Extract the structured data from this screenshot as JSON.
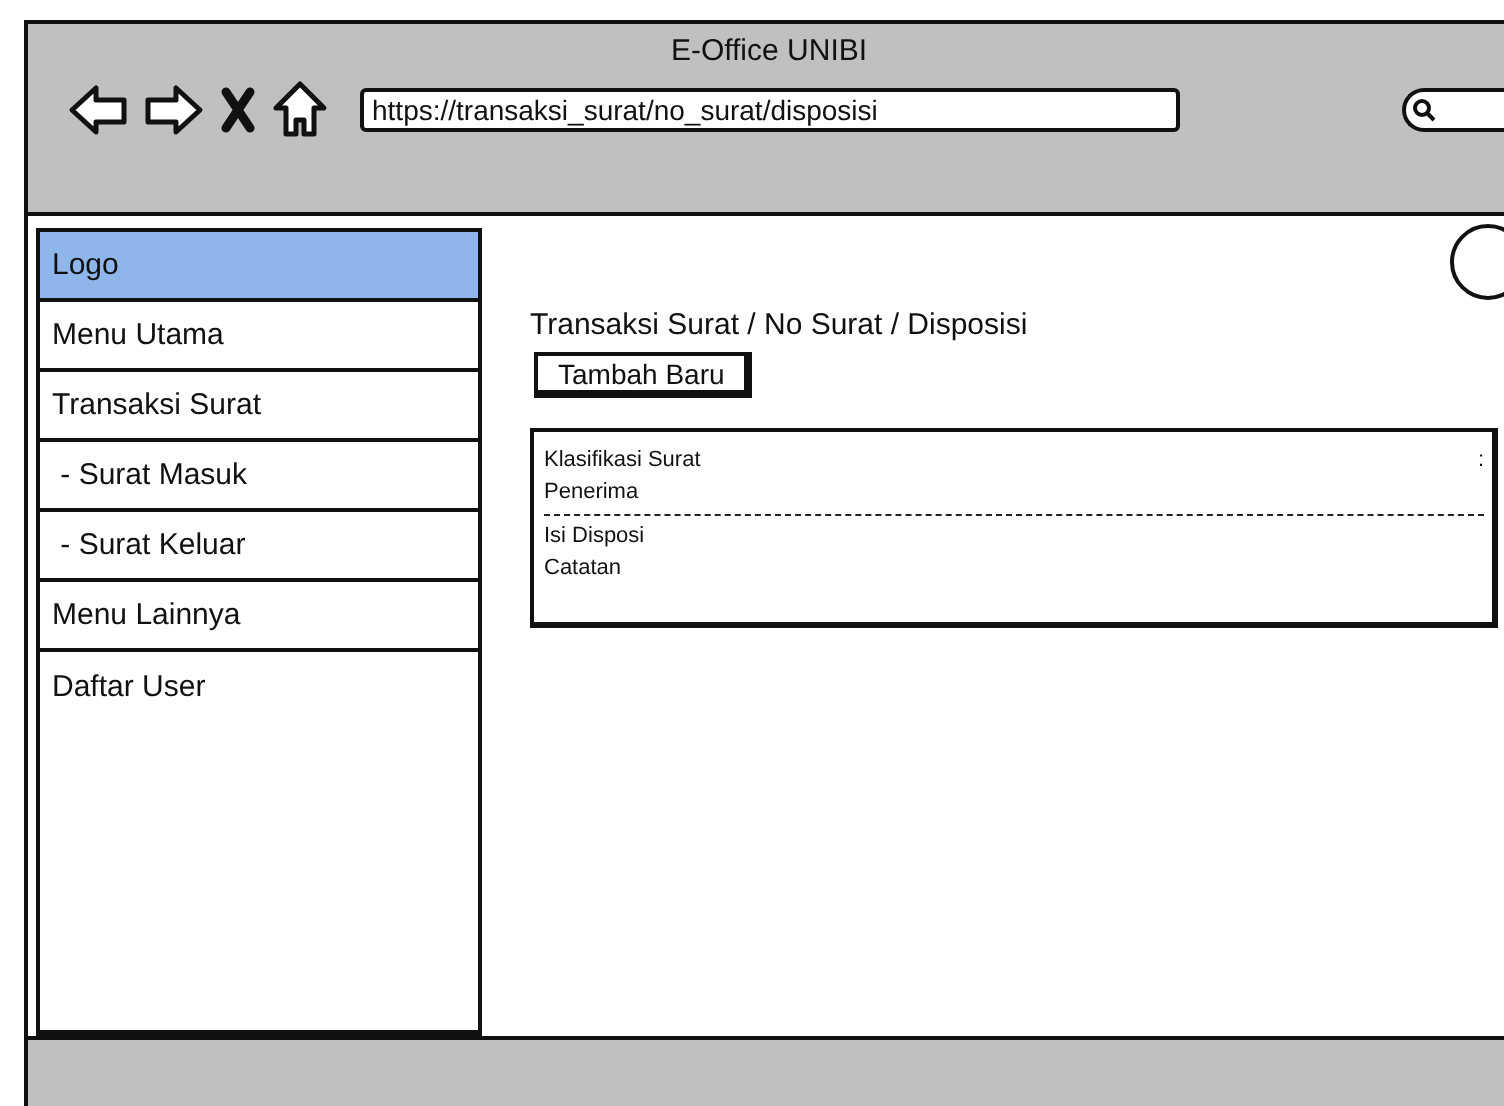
{
  "window": {
    "title": "E-Office UNIBI"
  },
  "address_bar": {
    "value": "https://transaksi_surat/no_surat/disposisi"
  },
  "sidebar": {
    "items": [
      {
        "label": "Logo",
        "selected": true
      },
      {
        "label": "Menu Utama",
        "selected": false
      },
      {
        "label": "Transaksi Surat",
        "selected": false
      },
      {
        "label": " - Surat Masuk",
        "selected": false
      },
      {
        "label": " - Surat Keluar",
        "selected": false
      },
      {
        "label": "Menu Lainnya",
        "selected": false
      },
      {
        "label": "Daftar User",
        "selected": false
      }
    ]
  },
  "breadcrumb": "Transaksi Surat / No Surat / Disposisi",
  "add_button": "Tambah Baru",
  "detail_card": {
    "sections": [
      {
        "rows": [
          {
            "label": "Klasifikasi Surat",
            "separator": ":"
          },
          {
            "label": "Penerima"
          }
        ]
      },
      {
        "rows": [
          {
            "label": "Isi Disposi"
          },
          {
            "label": "Catatan"
          }
        ]
      }
    ]
  }
}
